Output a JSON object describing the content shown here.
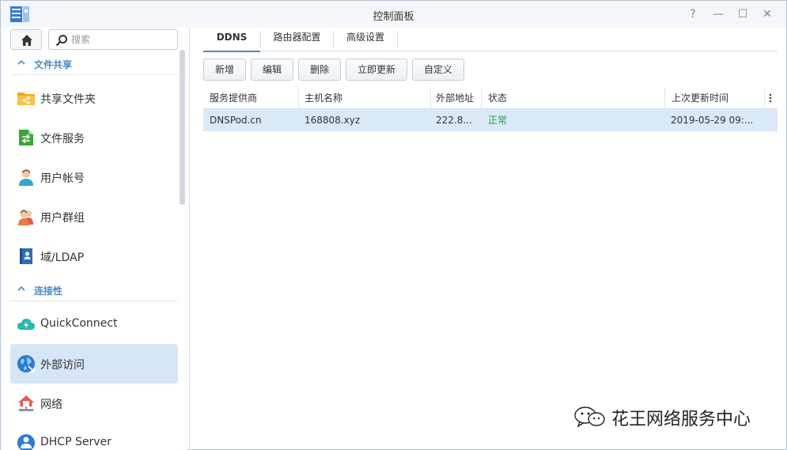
{
  "window": {
    "title": "控制面板",
    "help_glyph": "?",
    "minimize_glyph": "—",
    "maximize_glyph": "☐",
    "close_glyph": "✕"
  },
  "sidebar": {
    "search_placeholder": "搜索",
    "sections": [
      {
        "label": "文件共享"
      },
      {
        "label": "连接性"
      }
    ],
    "items": [
      {
        "label": "共享文件夹",
        "icon": "shared-folder-icon"
      },
      {
        "label": "文件服务",
        "icon": "file-services-icon"
      },
      {
        "label": "用户帐号",
        "icon": "user-icon"
      },
      {
        "label": "用户群组",
        "icon": "group-icon"
      },
      {
        "label": "域/LDAP",
        "icon": "domain-ldap-icon"
      },
      {
        "label": "QuickConnect",
        "icon": "quickconnect-icon"
      },
      {
        "label": "外部访问",
        "icon": "external-access-icon",
        "active": true
      },
      {
        "label": "网络",
        "icon": "network-icon"
      },
      {
        "label": "DHCP Server",
        "icon": "dhcp-server-icon"
      }
    ]
  },
  "tabs": [
    {
      "label": "DDNS",
      "active": true
    },
    {
      "label": "路由器配置"
    },
    {
      "label": "高级设置"
    }
  ],
  "toolbar": {
    "add_label": "新增",
    "edit_label": "编辑",
    "delete_label": "删除",
    "update_now_label": "立即更新",
    "customize_label": "自定义"
  },
  "table": {
    "columns": [
      "服务提供商",
      "主机名称",
      "外部地址",
      "状态",
      "上次更新时间"
    ],
    "rows": [
      {
        "provider": "DNSPod.cn",
        "hostname": "168808.xyz",
        "external_address": "222.8...",
        "status": "正常",
        "last_update": "2019-05-29 09:..."
      }
    ]
  },
  "watermark": {
    "text": "花王网络服务中心"
  },
  "colors": {
    "accent": "#4f8ac3",
    "selected_row": "#dae8f7",
    "active_nav": "#d6e6f6",
    "status_ok": "#2ea043"
  }
}
